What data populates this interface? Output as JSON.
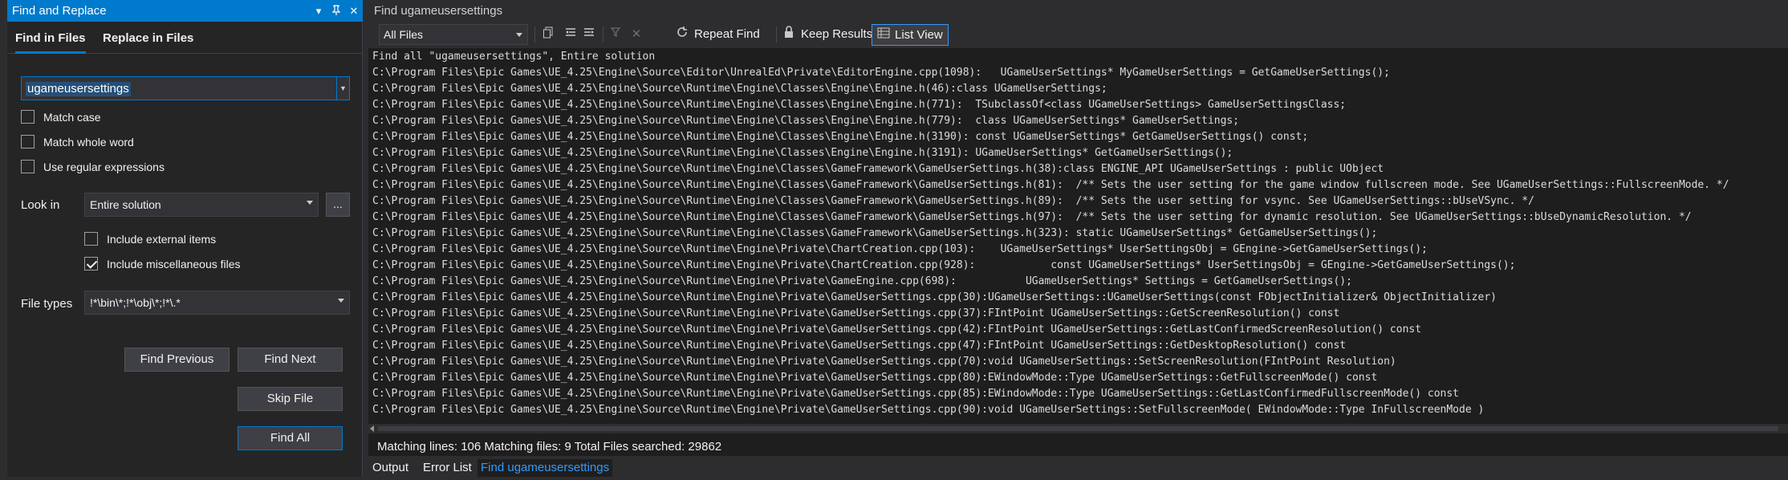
{
  "find_replace": {
    "title": "Find and Replace",
    "title_buttons": [
      "▾",
      "⊓",
      "✕"
    ],
    "tabs": [
      "Find in Files",
      "Replace in Files"
    ],
    "search_value": "ugameusersettings",
    "options": [
      {
        "label": "Match case",
        "checked": false
      },
      {
        "label": "Match whole word",
        "checked": false
      },
      {
        "label": "Use regular expressions",
        "checked": false
      }
    ],
    "look_in_label": "Look in",
    "look_in_value": "Entire solution",
    "browse_label": "...",
    "include_options": [
      {
        "label": "Include external items",
        "checked": false
      },
      {
        "label": "Include miscellaneous files",
        "checked": true
      }
    ],
    "file_types_label": "File types",
    "file_types_value": "!*\\bin\\*;!*\\obj\\*;!*\\.*",
    "buttons": {
      "find_previous": "Find Previous",
      "find_next": "Find Next",
      "skip_file": "Skip File",
      "find_all": "Find All"
    }
  },
  "results": {
    "title": "Find ugameusersettings",
    "scope": "All Files",
    "repeat_find": "Repeat Find",
    "keep_results": "Keep Results",
    "list_view": "List View",
    "lines": [
      "Find all \"ugameusersettings\", Entire solution",
      "C:\\Program Files\\Epic Games\\UE_4.25\\Engine\\Source\\Editor\\UnrealEd\\Private\\EditorEngine.cpp(1098):   UGameUserSettings* MyGameUserSettings = GetGameUserSettings();",
      "C:\\Program Files\\Epic Games\\UE_4.25\\Engine\\Source\\Runtime\\Engine\\Classes\\Engine\\Engine.h(46):class UGameUserSettings;",
      "C:\\Program Files\\Epic Games\\UE_4.25\\Engine\\Source\\Runtime\\Engine\\Classes\\Engine\\Engine.h(771):  TSubclassOf<class UGameUserSettings> GameUserSettingsClass;",
      "C:\\Program Files\\Epic Games\\UE_4.25\\Engine\\Source\\Runtime\\Engine\\Classes\\Engine\\Engine.h(779):  class UGameUserSettings* GameUserSettings;",
      "C:\\Program Files\\Epic Games\\UE_4.25\\Engine\\Source\\Runtime\\Engine\\Classes\\Engine\\Engine.h(3190): const UGameUserSettings* GetGameUserSettings() const;",
      "C:\\Program Files\\Epic Games\\UE_4.25\\Engine\\Source\\Runtime\\Engine\\Classes\\Engine\\Engine.h(3191): UGameUserSettings* GetGameUserSettings();",
      "C:\\Program Files\\Epic Games\\UE_4.25\\Engine\\Source\\Runtime\\Engine\\Classes\\GameFramework\\GameUserSettings.h(38):class ENGINE_API UGameUserSettings : public UObject",
      "C:\\Program Files\\Epic Games\\UE_4.25\\Engine\\Source\\Runtime\\Engine\\Classes\\GameFramework\\GameUserSettings.h(81):  /** Sets the user setting for the game window fullscreen mode. See UGameUserSettings::FullscreenMode. */",
      "C:\\Program Files\\Epic Games\\UE_4.25\\Engine\\Source\\Runtime\\Engine\\Classes\\GameFramework\\GameUserSettings.h(89):  /** Sets the user setting for vsync. See UGameUserSettings::bUseVSync. */",
      "C:\\Program Files\\Epic Games\\UE_4.25\\Engine\\Source\\Runtime\\Engine\\Classes\\GameFramework\\GameUserSettings.h(97):  /** Sets the user setting for dynamic resolution. See UGameUserSettings::bUseDynamicResolution. */",
      "C:\\Program Files\\Epic Games\\UE_4.25\\Engine\\Source\\Runtime\\Engine\\Classes\\GameFramework\\GameUserSettings.h(323): static UGameUserSettings* GetGameUserSettings();",
      "C:\\Program Files\\Epic Games\\UE_4.25\\Engine\\Source\\Runtime\\Engine\\Private\\ChartCreation.cpp(103):    UGameUserSettings* UserSettingsObj = GEngine->GetGameUserSettings();",
      "C:\\Program Files\\Epic Games\\UE_4.25\\Engine\\Source\\Runtime\\Engine\\Private\\ChartCreation.cpp(928):            const UGameUserSettings* UserSettingsObj = GEngine->GetGameUserSettings();",
      "C:\\Program Files\\Epic Games\\UE_4.25\\Engine\\Source\\Runtime\\Engine\\Private\\GameEngine.cpp(698):           UGameUserSettings* Settings = GetGameUserSettings();",
      "C:\\Program Files\\Epic Games\\UE_4.25\\Engine\\Source\\Runtime\\Engine\\Private\\GameUserSettings.cpp(30):UGameUserSettings::UGameUserSettings(const FObjectInitializer& ObjectInitializer)",
      "C:\\Program Files\\Epic Games\\UE_4.25\\Engine\\Source\\Runtime\\Engine\\Private\\GameUserSettings.cpp(37):FIntPoint UGameUserSettings::GetScreenResolution() const",
      "C:\\Program Files\\Epic Games\\UE_4.25\\Engine\\Source\\Runtime\\Engine\\Private\\GameUserSettings.cpp(42):FIntPoint UGameUserSettings::GetLastConfirmedScreenResolution() const",
      "C:\\Program Files\\Epic Games\\UE_4.25\\Engine\\Source\\Runtime\\Engine\\Private\\GameUserSettings.cpp(47):FIntPoint UGameUserSettings::GetDesktopResolution() const",
      "C:\\Program Files\\Epic Games\\UE_4.25\\Engine\\Source\\Runtime\\Engine\\Private\\GameUserSettings.cpp(70):void UGameUserSettings::SetScreenResolution(FIntPoint Resolution)",
      "C:\\Program Files\\Epic Games\\UE_4.25\\Engine\\Source\\Runtime\\Engine\\Private\\GameUserSettings.cpp(80):EWindowMode::Type UGameUserSettings::GetFullscreenMode() const",
      "C:\\Program Files\\Epic Games\\UE_4.25\\Engine\\Source\\Runtime\\Engine\\Private\\GameUserSettings.cpp(85):EWindowMode::Type UGameUserSettings::GetLastConfirmedFullscreenMode() const",
      "C:\\Program Files\\Epic Games\\UE_4.25\\Engine\\Source\\Runtime\\Engine\\Private\\GameUserSettings.cpp(90):void UGameUserSettings::SetFullscreenMode( EWindowMode::Type InFullscreenMode )"
    ],
    "status": "Matching lines: 106 Matching files: 9 Total Files searched: 29862"
  },
  "bottom_tabs": [
    "Output",
    "Error List",
    "Find ugameusersettings"
  ],
  "colors": {
    "accent": "#007acc",
    "panel": "#252526",
    "editor": "#1e1e1e",
    "active_tab_text": "#3399ff"
  }
}
